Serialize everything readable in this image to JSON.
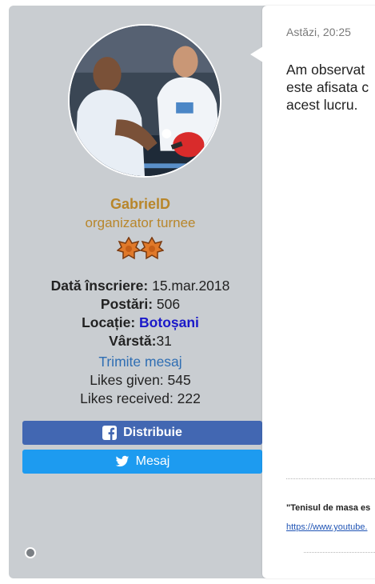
{
  "user": {
    "username": "GabrielD",
    "title": "organizator turnee",
    "rank_badge_icons": [
      "rank-star-icon",
      "rank-star-icon"
    ],
    "join_label": "Dată înscriere:",
    "join_value": " 15.mar.2018",
    "posts_label": "Postări:",
    "posts_value": " 506",
    "location_label": "Locație:",
    "location_value": "Botoșani",
    "age_label": "Vârstă:",
    "age_value": "31",
    "send_message": "Trimite mesaj",
    "likes_given": "Likes given: 545",
    "likes_received": "Likes received: 222",
    "status": "offline"
  },
  "share": {
    "facebook_label": "Distribuie",
    "facebook_icon": "facebook-icon",
    "facebook_color": "#4267b2",
    "twitter_label": "Mesaj",
    "twitter_icon": "twitter-icon",
    "twitter_color": "#1d9bf0"
  },
  "post": {
    "date": "Astăzi, 20:25",
    "lines": [
      "Am observat",
      "este afisata c",
      "acest lucru."
    ],
    "signature_quote": "\"Tenisul de masa es",
    "signature_link": "https://www.youtube."
  },
  "colors": {
    "username": "#b8862b",
    "panel_background": "#c9cdd1",
    "location_link": "#1a19c9",
    "message_link": "#2f6eb3"
  }
}
